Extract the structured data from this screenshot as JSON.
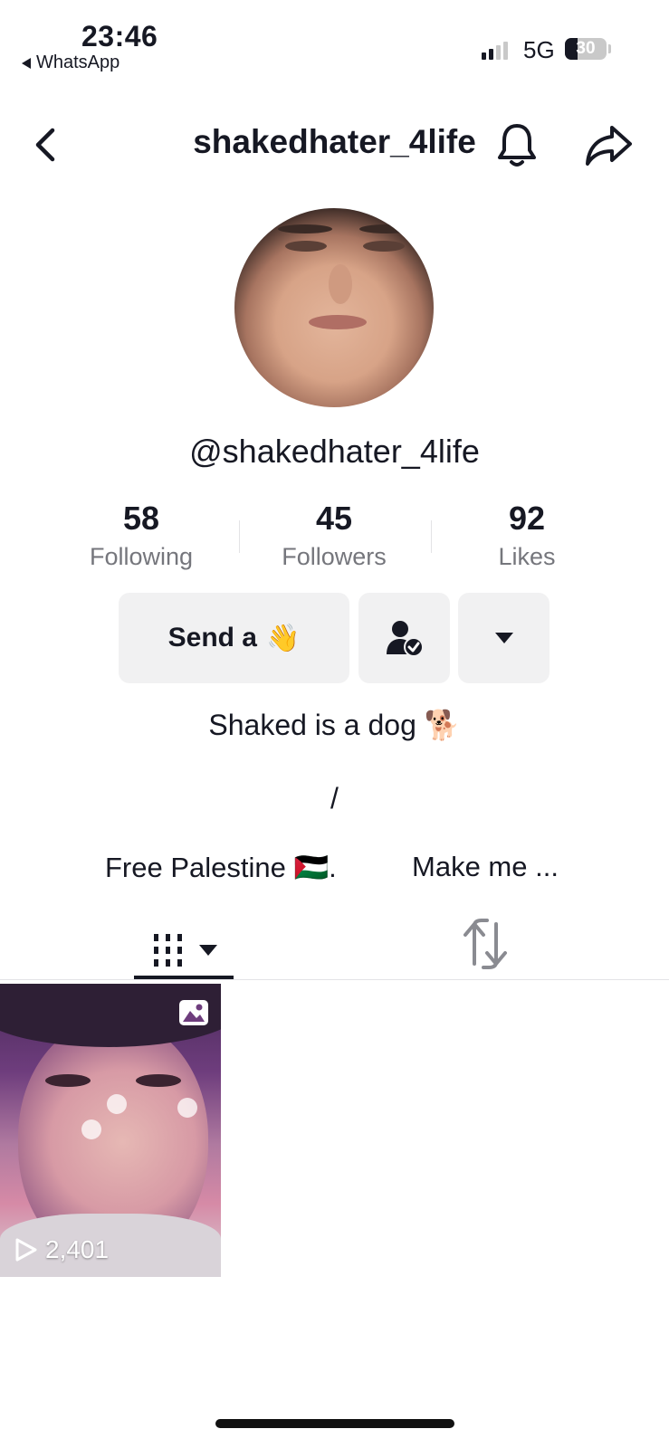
{
  "status_bar": {
    "time": "23:46",
    "back_app": "WhatsApp",
    "network": "5G",
    "battery": "30",
    "battery_level": 0.3
  },
  "header": {
    "title": "shakedhater_4life",
    "icons": [
      "chevron-left-icon",
      "bell-icon",
      "share-icon"
    ]
  },
  "profile": {
    "handle": "@shakedhater_4life",
    "stats": [
      {
        "value": "58",
        "label": "Following"
      },
      {
        "value": "45",
        "label": "Followers"
      },
      {
        "value": "92",
        "label": "Likes"
      }
    ],
    "buttons": {
      "send": "Send a",
      "send_emoji": "👋"
    },
    "bio_line1": "Shaked is a dog 🐕",
    "bio_line2": "/",
    "links": [
      "Free Palestine 🇵🇸.",
      "Make me ..."
    ]
  },
  "tabs": {
    "items": [
      "videos-grid-tab",
      "reposts-tab"
    ]
  },
  "videos": [
    {
      "views": "2,401",
      "type": "photo-post"
    }
  ]
}
